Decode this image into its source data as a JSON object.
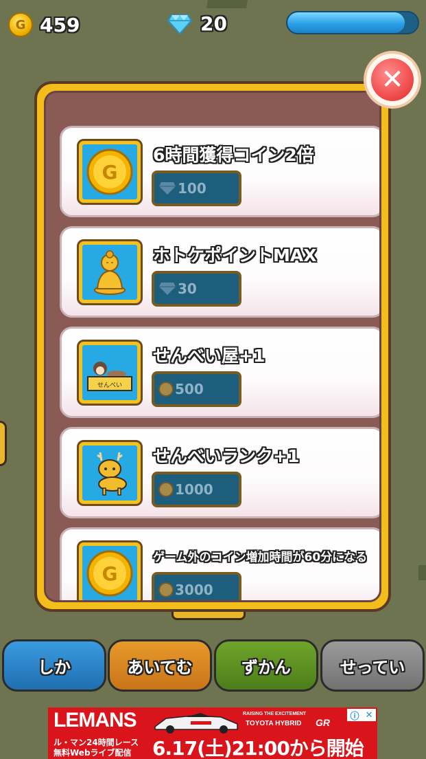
{
  "hud": {
    "coins": "459",
    "gems": "20",
    "energy_fraction": 0.9
  },
  "icons": {
    "coin": "coin-icon",
    "gem": "diamond-icon",
    "close": "close-icon"
  },
  "shop": {
    "items": [
      {
        "title": "6時間獲得コイン2倍",
        "currency": "gem",
        "price": "100",
        "image": "gold-coin"
      },
      {
        "title": "ホトケポイントMAX",
        "currency": "gem",
        "price": "30",
        "image": "buddha-statue"
      },
      {
        "title": "せんべい屋+1",
        "currency": "coin",
        "price": "500",
        "image": "senbei-shop",
        "image_text": "せんべい"
      },
      {
        "title": "せんべいランク+1",
        "currency": "coin",
        "price": "1000",
        "image": "deer"
      },
      {
        "title": "ゲーム外のコイン増加時間が60分になる",
        "currency": "coin",
        "price": "3000",
        "image": "gold-coin"
      }
    ]
  },
  "tabs": {
    "shika": "しか",
    "item": "あいてむ",
    "zukan": "ずかん",
    "settei": "せってい"
  },
  "ad": {
    "logo": "LEMANS",
    "raising": "RAISING THE EXCITEMENT",
    "toyota": "TOYOTA HYBRID",
    "gr": "GR",
    "line1": "ル・マン24時間レース",
    "line2": "無料Webライブ配信",
    "date": "6.17(土)21:00から開始",
    "info_glyph": "ⓘ",
    "close_glyph": "✕"
  },
  "colors": {
    "background": "#6f7450",
    "panel_frame": "#f3be1b",
    "panel_inner": "#8a5b55",
    "price_box": "#1e5e7d",
    "close_red": "#ef4a4a",
    "ad_red": "#d9141a"
  }
}
